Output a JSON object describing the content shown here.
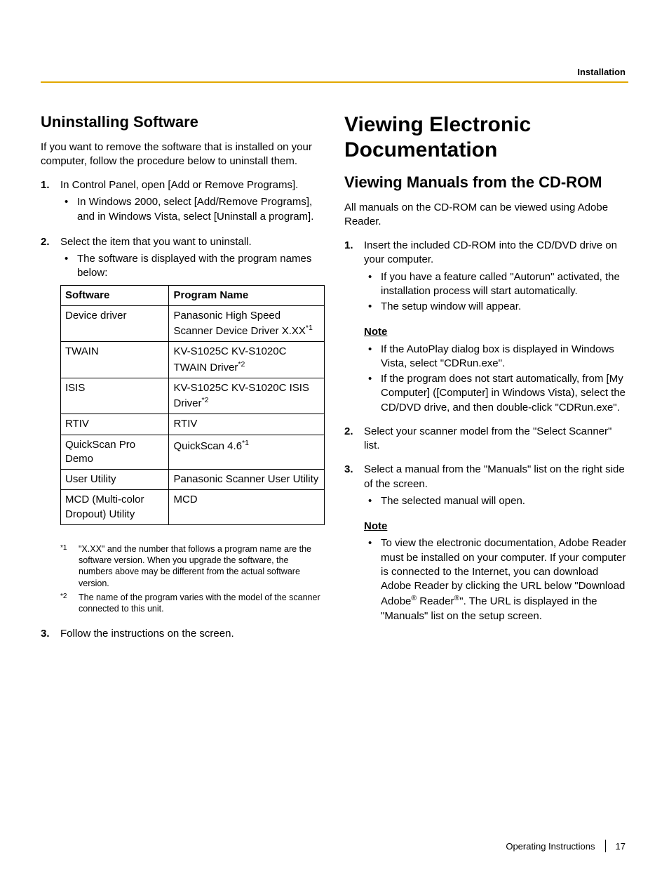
{
  "header": {
    "section": "Installation"
  },
  "left": {
    "heading": "Uninstalling Software",
    "intro": "If you want to remove the software that is installed on your computer, follow the procedure below to uninstall them.",
    "step1": {
      "num": "1.",
      "text": "In Control Panel, open [Add or Remove Programs].",
      "bullet1": "In Windows 2000, select [Add/Remove Programs], and in Windows Vista, select [Uninstall a program]."
    },
    "step2": {
      "num": "2.",
      "text": "Select the item that you want to uninstall.",
      "bullet1": "The software is displayed with the program names below:"
    },
    "table": {
      "h1": "Software",
      "h2": "Program Name",
      "r1c1": "Device driver",
      "r1c2a": "Panasonic High Speed Scanner Device Driver X.XX",
      "r1c2s": "*1",
      "r2c1": "TWAIN",
      "r2c2a": "KV-S1025C KV-S1020C TWAIN Driver",
      "r2c2s": "*2",
      "r3c1": "ISIS",
      "r3c2a": "KV-S1025C KV-S1020C ISIS Driver",
      "r3c2s": "*2",
      "r4c1": "RTIV",
      "r4c2": "RTIV",
      "r5c1": "QuickScan Pro Demo",
      "r5c2a": "QuickScan 4.6",
      "r5c2s": "*1",
      "r6c1": "User Utility",
      "r6c2": "Panasonic Scanner User Utility",
      "r7c1": "MCD (Multi-color Dropout) Utility",
      "r7c2": "MCD"
    },
    "fn1mark": "*1",
    "fn1text": "\"X.XX\" and the number that follows a program name are the software version. When you upgrade the software, the numbers above may be different from the actual software version.",
    "fn2mark": "*2",
    "fn2text": "The name of the program varies with the model of the scanner connected to this unit.",
    "step3": {
      "num": "3.",
      "text": "Follow the instructions on the screen."
    }
  },
  "right": {
    "h1": "Viewing Electronic Documentation",
    "h2": "Viewing Manuals from the CD-ROM",
    "intro": "All manuals on the CD-ROM can be viewed using Adobe Reader.",
    "step1": {
      "num": "1.",
      "text": "Insert the included CD-ROM into the CD/DVD drive on your computer.",
      "bullet1": "If you have a feature called \"Autorun\" activated, the installation process will start automatically.",
      "bullet2": "The setup window will appear."
    },
    "note1": {
      "label": "Note",
      "bullet1": "If the AutoPlay dialog box is displayed in Windows Vista, select \"CDRun.exe\".",
      "bullet2": "If the program does not start automatically, from [My Computer] ([Computer] in Windows Vista), select the CD/DVD drive, and then double-click \"CDRun.exe\"."
    },
    "step2": {
      "num": "2.",
      "text": "Select your scanner model from the \"Select Scanner\" list."
    },
    "step3": {
      "num": "3.",
      "text": "Select a manual from the \"Manuals\" list on the right side of the screen.",
      "bullet1": "The selected manual will open."
    },
    "note2": {
      "label": "Note",
      "bullet1a": "To view the electronic documentation, Adobe Reader must be installed on your computer. If your computer is connected to the Internet, you can download Adobe Reader by clicking the URL below \"Download Adobe",
      "bullet1b": " Reader",
      "bullet1c": "\". The URL is displayed in the \"Manuals\" list on the setup screen."
    }
  },
  "footer": {
    "label": "Operating Instructions",
    "page": "17"
  }
}
